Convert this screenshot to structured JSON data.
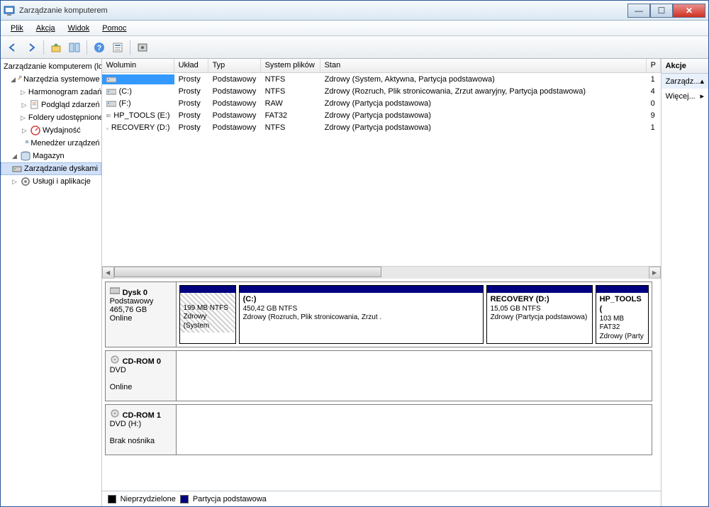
{
  "window": {
    "title": "Zarządzanie komputerem"
  },
  "menu": {
    "file": "Plik",
    "action": "Akcja",
    "view": "Widok",
    "help": "Pomoc"
  },
  "tree": {
    "root": "Zarządzanie komputerem (lokalne)",
    "tools": "Narzędzia systemowe",
    "scheduler": "Harmonogram zadań",
    "eventviewer": "Podgląd zdarzeń",
    "sharedfolders": "Foldery udostępnione",
    "performance": "Wydajność",
    "devmgr": "Menedżer urządzeń",
    "storage": "Magazyn",
    "diskmgmt": "Zarządzanie dyskami",
    "services": "Usługi i aplikacje"
  },
  "columns": {
    "volume": "Wolumin",
    "layout": "Układ",
    "type": "Typ",
    "fs": "System plików",
    "status": "Stan",
    "p": "P"
  },
  "volumes": [
    {
      "name": "",
      "layout": "Prosty",
      "type": "Podstawowy",
      "fs": "NTFS",
      "status": "Zdrowy (System, Aktywna, Partycja podstawowa)",
      "p": "1"
    },
    {
      "name": "(C:)",
      "layout": "Prosty",
      "type": "Podstawowy",
      "fs": "NTFS",
      "status": "Zdrowy (Rozruch, Plik stronicowania, Zrzut awaryjny, Partycja podstawowa)",
      "p": "4"
    },
    {
      "name": "(F:)",
      "layout": "Prosty",
      "type": "Podstawowy",
      "fs": "RAW",
      "status": "Zdrowy (Partycja podstawowa)",
      "p": "0"
    },
    {
      "name": "HP_TOOLS (E:)",
      "layout": "Prosty",
      "type": "Podstawowy",
      "fs": "FAT32",
      "status": "Zdrowy (Partycja podstawowa)",
      "p": "9"
    },
    {
      "name": "RECOVERY (D:)",
      "layout": "Prosty",
      "type": "Podstawowy",
      "fs": "NTFS",
      "status": "Zdrowy (Partycja podstawowa)",
      "p": "1"
    }
  ],
  "disks": {
    "disk0": {
      "title": "Dysk 0",
      "type": "Podstawowy",
      "size": "465,76 GB",
      "state": "Online"
    },
    "cdrom0": {
      "title": "CD-ROM 0",
      "type": "DVD",
      "state": "Online"
    },
    "cdrom1": {
      "title": "CD-ROM 1",
      "type": "DVD (H:)",
      "state": "Brak nośnika"
    }
  },
  "partitions": {
    "p0": {
      "size": "199 MB NTFS",
      "status": "Zdrowy (System"
    },
    "p1": {
      "name": "(C:)",
      "size": "450,42 GB NTFS",
      "status": "Zdrowy (Rozruch, Plik stronicowania, Zrzut ."
    },
    "p2": {
      "name": "RECOVERY (D:)",
      "size": "15,05 GB NTFS",
      "status": "Zdrowy (Partycja podstawowa)"
    },
    "p3": {
      "name": "HP_TOOLS (",
      "size": "103 MB FAT32",
      "status": "Zdrowy (Party"
    }
  },
  "legend": {
    "unallocated": "Nieprzydzielone",
    "primary": "Partycja podstawowa"
  },
  "actions": {
    "header": "Akcje",
    "manage": "Zarządz...",
    "more": "Więcej..."
  }
}
